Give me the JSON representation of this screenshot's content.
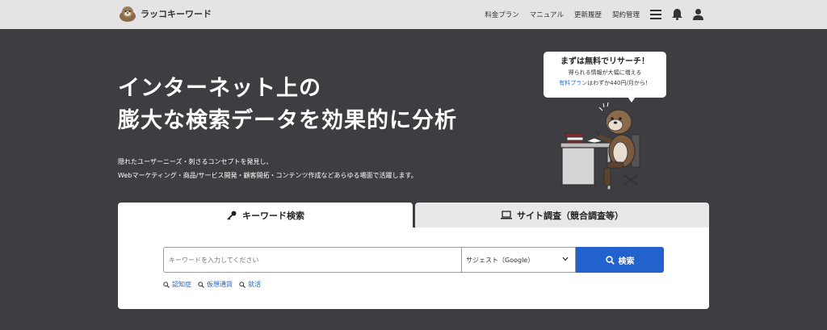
{
  "header": {
    "logo_text": "ラッコキーワード",
    "nav": [
      "料金プラン",
      "マニュアル",
      "更新履歴",
      "契約管理"
    ],
    "icons": [
      "menu-icon",
      "bell-icon",
      "user-icon"
    ]
  },
  "hero": {
    "title_line1": "インターネット上の",
    "title_line2": "膨大な検索データを効果的に分析",
    "desc_line1": "隠れたユーザーニーズ・刺さるコンセプトを発見し、",
    "desc_line2": "Webマーケティング・商品/サービス開発・顧客開拓・コンテンツ作成などあらゆる場面で活躍します。"
  },
  "bubble": {
    "main": "まずは無料でリサーチ！",
    "sub1": "得られる情報が大幅に増える",
    "link": "有料プラン",
    "sub2": "はわずか440円/月から！"
  },
  "tabs": {
    "keyword": "キーワード検索",
    "site": "サイト調査（競合調査等）"
  },
  "search": {
    "placeholder": "キーワードを入力してください",
    "select_value": "サジェスト（Google）",
    "button": "検索",
    "suggestions": [
      "認知症",
      "仮想通貨",
      "就活"
    ]
  },
  "colors": {
    "background": "#3d3d42",
    "header": "#e4e4e4",
    "accent": "#2262cc"
  }
}
